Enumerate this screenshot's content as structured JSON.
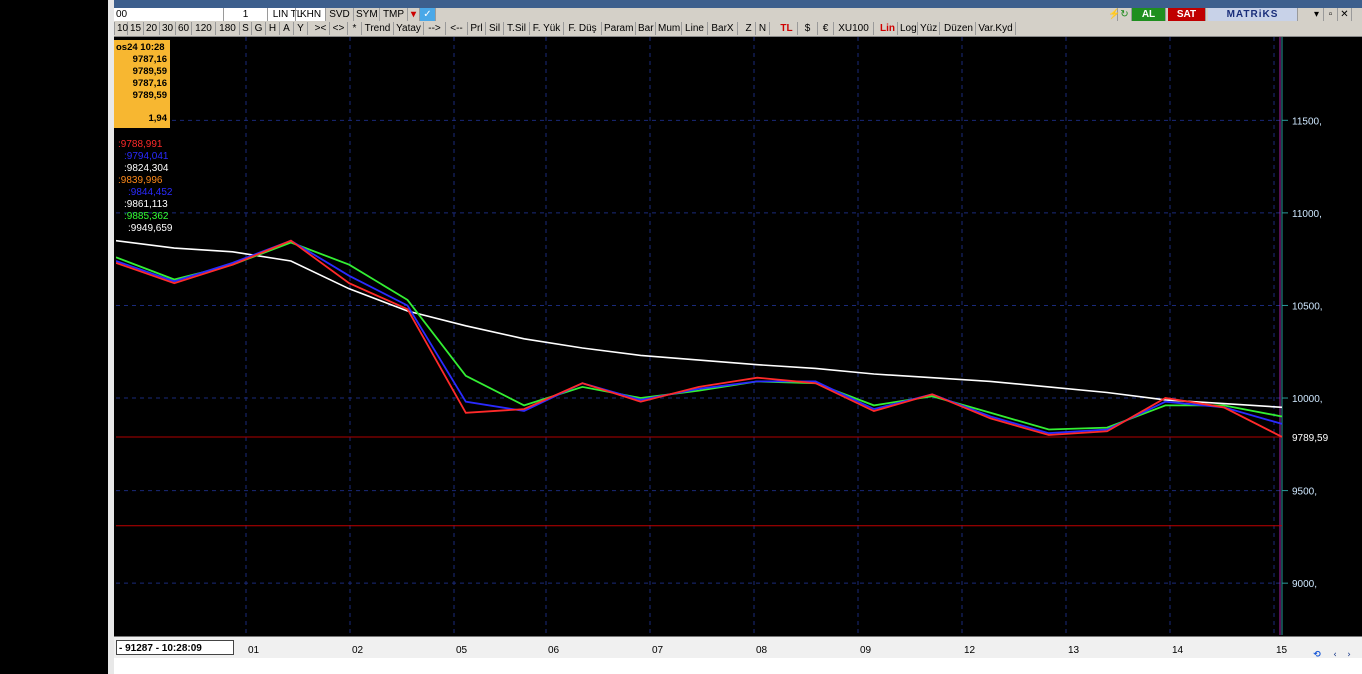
{
  "toolbar_row1": {
    "cells": [
      "00",
      "1",
      "TL",
      "LIN",
      "KHN",
      "SVD",
      "SYM",
      "TMP"
    ],
    "al_label": "AL",
    "sat_label": "SAT",
    "logo": "MATRiKS"
  },
  "toolbar_row2": {
    "cells": [
      "10",
      "15",
      "20",
      "30",
      "60",
      "120",
      "180",
      "S",
      "G",
      "H",
      "A",
      "Y",
      "><",
      "<>",
      "*",
      "Trend",
      "Yatay",
      "-->",
      "<--",
      "Prl",
      "Sil",
      "T.Sil",
      "F. Yük",
      "F. Düş",
      "Param",
      "Bar",
      "Mum",
      "Line",
      "BarX",
      "Z",
      "N",
      "TL",
      "$",
      "€",
      "XU100",
      "Lin",
      "Log",
      "Yüz",
      "Düzen",
      "Var.Kyd"
    ],
    "red_cells": [
      "TL",
      "Lin"
    ]
  },
  "info_box": {
    "datetime": "os24 10:28",
    "open": "9787,16",
    "high": "9789,59",
    "low": "9787,16",
    "close": "9789,59",
    "change": "1,94"
  },
  "indicators": [
    {
      "value": ":9788,991",
      "color": "#ff2a2a"
    },
    {
      "value": ":9794,041",
      "color": "#2a2aff"
    },
    {
      "value": ":9824,304",
      "color": "#ffffff"
    },
    {
      "value": ":9839,996",
      "color": "#ff8a1a"
    },
    {
      "value": ":9844,452",
      "color": "#2a2aff"
    },
    {
      "value": ":9861,113",
      "color": "#ffffff"
    },
    {
      "value": ":9885,362",
      "color": "#33ff33"
    },
    {
      "value": ":9949,659",
      "color": "#ffffff"
    }
  ],
  "chart_data": {
    "type": "line",
    "y_ticks": [
      "11500,",
      "11000,",
      "10500,",
      "10000,",
      "9500,",
      "9000,"
    ],
    "y_tick_values": [
      11500,
      11000,
      10500,
      10000,
      9500,
      9000
    ],
    "ylim": [
      8720,
      11950
    ],
    "last_price_label": "9789,59",
    "last_price": 9789.59,
    "lower_red_line": 9310,
    "x_labels": [
      "01",
      "02",
      "05",
      "06",
      "07",
      "08",
      "09",
      "12",
      "13",
      "14",
      "15"
    ],
    "x": [
      0,
      5,
      10,
      15,
      20,
      25,
      30,
      35,
      40,
      45,
      50,
      55,
      60,
      65,
      70,
      75,
      80,
      85,
      90,
      95,
      100
    ],
    "series": [
      {
        "color": "#ffffff",
        "values": [
          10850,
          10810,
          10790,
          10740,
          10590,
          10470,
          10390,
          10320,
          10270,
          10230,
          10205,
          10180,
          10160,
          10130,
          10110,
          10090,
          10060,
          10030,
          9990,
          9970,
          9950
        ]
      },
      {
        "color": "#33ee33",
        "values": [
          10760,
          10640,
          10720,
          10840,
          10720,
          10530,
          10120,
          9960,
          10060,
          10000,
          10040,
          10090,
          10080,
          9960,
          10010,
          9920,
          9830,
          9840,
          9960,
          9960,
          9900
        ]
      },
      {
        "color": "#2a2aff",
        "values": [
          10740,
          10630,
          10730,
          10850,
          10660,
          10500,
          9980,
          9930,
          10080,
          9990,
          10050,
          10090,
          10090,
          9940,
          10020,
          9900,
          9810,
          9830,
          9980,
          9950,
          9860
        ]
      },
      {
        "color": "#ff2a2a",
        "values": [
          10730,
          10620,
          10720,
          10850,
          10620,
          10480,
          9920,
          9940,
          10080,
          9980,
          10060,
          10110,
          10080,
          9930,
          10020,
          9890,
          9800,
          9820,
          10000,
          9950,
          9790
        ]
      }
    ],
    "grid": true
  },
  "status_text": "- 91287 - 10:28:09",
  "nav": [
    "‹",
    "›"
  ]
}
